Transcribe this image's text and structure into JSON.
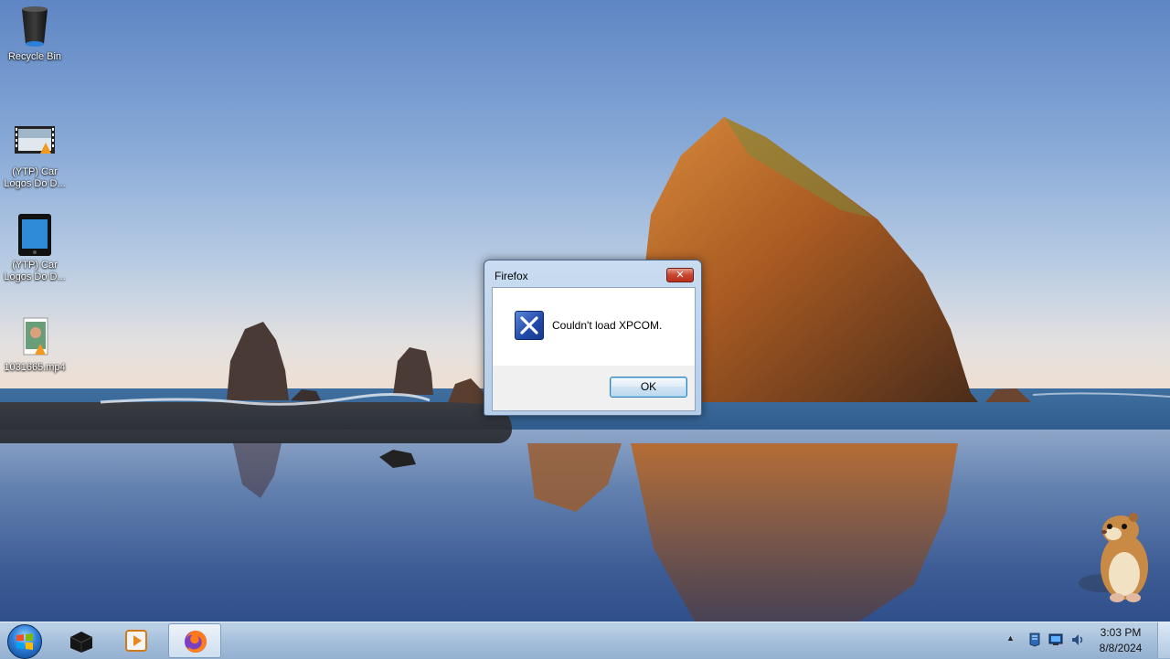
{
  "desktop": {
    "icons": [
      {
        "label": "Recycle Bin",
        "icon": "recycle-bin-icon"
      },
      {
        "label": "(YTP) Car Logos Do D...",
        "icon": "video-file-icon"
      },
      {
        "label": "(YTP) Car Logos Do D...",
        "icon": "tablet-file-icon"
      },
      {
        "label": "1031665.mp4",
        "icon": "mp4-file-icon"
      }
    ]
  },
  "dialog": {
    "title": "Firefox",
    "close_label": "✕",
    "message": "Couldn't load XPCOM.",
    "ok_label": "OK",
    "icon": "error-x-icon"
  },
  "taskbar": {
    "start": "windows-start-orb",
    "pinned": [
      {
        "name": "taskbar-item-black-box",
        "icon": "black-box-icon"
      },
      {
        "name": "taskbar-item-media-player",
        "icon": "media-player-icon"
      },
      {
        "name": "taskbar-item-firefox",
        "icon": "firefox-icon",
        "active": true
      }
    ],
    "tray": {
      "time": "3:03 PM",
      "date": "8/8/2024",
      "overflow_arrow": "▲"
    }
  },
  "gadget": {
    "icon": "hamster-icon"
  },
  "colors": {
    "taskbar": "#aac3de",
    "dialog_frame": "#b6cde8",
    "close_button": "#c7452f",
    "accent": "#3c7fb1"
  }
}
